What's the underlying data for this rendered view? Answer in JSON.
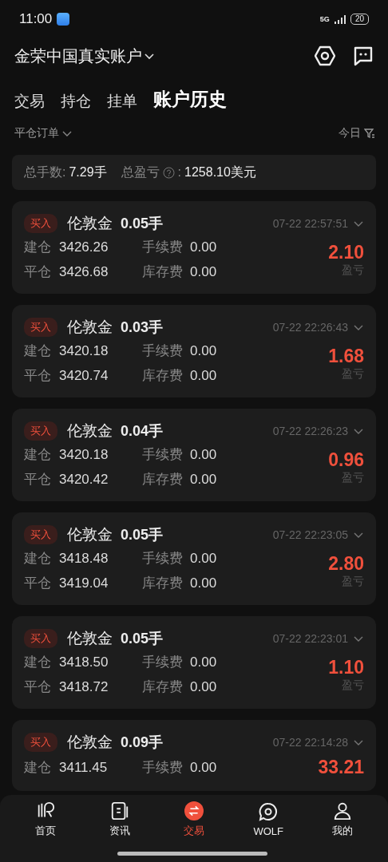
{
  "status_bar": {
    "time": "11:00",
    "network": "5G",
    "battery": "20"
  },
  "header": {
    "account": "金荣中国真实账户"
  },
  "tabs": [
    {
      "label": "交易",
      "selected": false
    },
    {
      "label": "持仓",
      "selected": false
    },
    {
      "label": "挂单",
      "selected": false
    },
    {
      "label": "账户历史",
      "selected": true
    }
  ],
  "filter": {
    "order_type": "平仓订单",
    "period": "今日"
  },
  "summary": {
    "lots_label": "总手数:",
    "lots": "7.29手",
    "pnl_label": "总盈亏",
    "pnl_colon": ":",
    "pnl": "1258.10美元"
  },
  "orders": [
    {
      "side": "买入",
      "symbol": "伦敦金",
      "lots": "0.05手",
      "time": "07-22 22:57:51",
      "open_label": "建仓",
      "open": "3426.26",
      "fee_label": "手续费",
      "fee": "0.00",
      "close_label": "平仓",
      "close": "3426.68",
      "swap_label": "库存费",
      "swap": "0.00",
      "pnl": "2.10",
      "pnl_label": "盈亏"
    },
    {
      "side": "买入",
      "symbol": "伦敦金",
      "lots": "0.03手",
      "time": "07-22 22:26:43",
      "open_label": "建仓",
      "open": "3420.18",
      "fee_label": "手续费",
      "fee": "0.00",
      "close_label": "平仓",
      "close": "3420.74",
      "swap_label": "库存费",
      "swap": "0.00",
      "pnl": "1.68",
      "pnl_label": "盈亏"
    },
    {
      "side": "买入",
      "symbol": "伦敦金",
      "lots": "0.04手",
      "time": "07-22 22:26:23",
      "open_label": "建仓",
      "open": "3420.18",
      "fee_label": "手续费",
      "fee": "0.00",
      "close_label": "平仓",
      "close": "3420.42",
      "swap_label": "库存费",
      "swap": "0.00",
      "pnl": "0.96",
      "pnl_label": "盈亏"
    },
    {
      "side": "买入",
      "symbol": "伦敦金",
      "lots": "0.05手",
      "time": "07-22 22:23:05",
      "open_label": "建仓",
      "open": "3418.48",
      "fee_label": "手续费",
      "fee": "0.00",
      "close_label": "平仓",
      "close": "3419.04",
      "swap_label": "库存费",
      "swap": "0.00",
      "pnl": "2.80",
      "pnl_label": "盈亏"
    },
    {
      "side": "买入",
      "symbol": "伦敦金",
      "lots": "0.05手",
      "time": "07-22 22:23:01",
      "open_label": "建仓",
      "open": "3418.50",
      "fee_label": "手续费",
      "fee": "0.00",
      "close_label": "平仓",
      "close": "3418.72",
      "swap_label": "库存费",
      "swap": "0.00",
      "pnl": "1.10",
      "pnl_label": "盈亏"
    },
    {
      "side": "买入",
      "symbol": "伦敦金",
      "lots": "0.09手",
      "time": "07-22 22:14:28",
      "open_label": "建仓",
      "open": "3411.45",
      "fee_label": "手续费",
      "fee": "0.00",
      "pnl": "33.21"
    }
  ],
  "bottom_nav": [
    {
      "label": "首页",
      "kind": "home",
      "selected": false
    },
    {
      "label": "资讯",
      "kind": "news",
      "selected": false
    },
    {
      "label": "交易",
      "kind": "trade",
      "selected": true
    },
    {
      "label": "WOLF",
      "kind": "chat",
      "selected": false
    },
    {
      "label": "我的",
      "kind": "user",
      "selected": false
    }
  ]
}
